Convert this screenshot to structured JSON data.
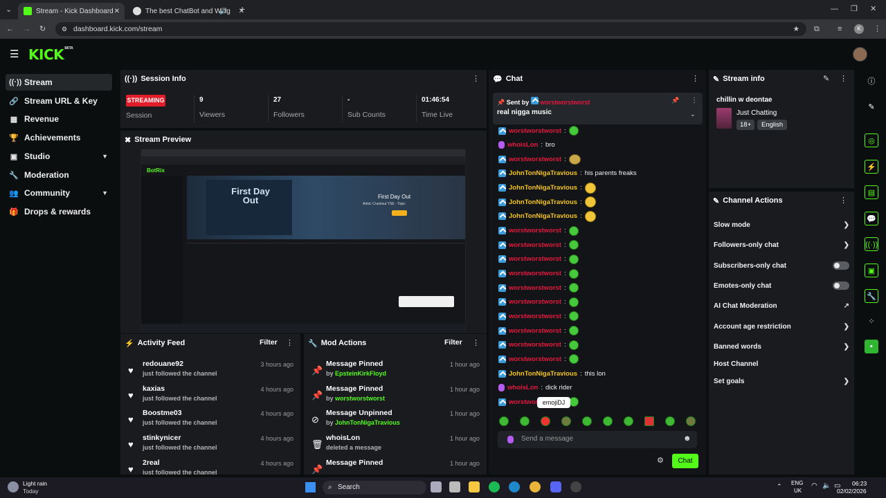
{
  "browser": {
    "tabs": [
      {
        "label": "Stream - Kick Dashboard"
      },
      {
        "label": "The best ChatBot and Widg"
      }
    ],
    "url": "dashboard.kick.com/stream",
    "profile_initial": "K"
  },
  "site": {
    "logo": "KICK",
    "logo_badge": "BETA"
  },
  "nav": {
    "items": [
      {
        "label": "Stream",
        "icon": "stream-icon"
      },
      {
        "label": "Stream URL & Key",
        "icon": "link-icon"
      },
      {
        "label": "Revenue",
        "icon": "revenue-icon"
      },
      {
        "label": "Achievements",
        "icon": "trophy-icon"
      },
      {
        "label": "Studio",
        "icon": "studio-icon"
      },
      {
        "label": "Moderation",
        "icon": "wrench-icon"
      },
      {
        "label": "Community",
        "icon": "community-icon"
      },
      {
        "label": "Drops & rewards",
        "icon": "gift-icon"
      }
    ]
  },
  "session": {
    "title": "Session Info",
    "badge": "STREAMING",
    "stats": [
      {
        "value": "",
        "label": "Session"
      },
      {
        "value": "9",
        "label": "Viewers"
      },
      {
        "value": "27",
        "label": "Followers"
      },
      {
        "value": "-",
        "label": "Sub Counts"
      },
      {
        "value": "01:46:54",
        "label": "Time Live"
      }
    ]
  },
  "preview": {
    "title": "Stream Preview",
    "inner_title": "First Day Out",
    "inner_artist": "Artist: Crashout YSE - Topic",
    "inner_brand": "BotRix"
  },
  "activity": {
    "title": "Activity Feed",
    "filter": "Filter",
    "rows": [
      {
        "name": "redouane92",
        "sub": "just followed the channel",
        "time": "3 hours ago"
      },
      {
        "name": "kaxias",
        "sub": "just followed the channel",
        "time": "4 hours ago"
      },
      {
        "name": "Boostme03",
        "sub": "just followed the channel",
        "time": "4 hours ago"
      },
      {
        "name": "stinkynicer",
        "sub": "just followed the channel",
        "time": "4 hours ago"
      },
      {
        "name": "2real",
        "sub": "just followed the channel",
        "time": "4 hours ago"
      }
    ]
  },
  "modactions": {
    "title": "Mod Actions",
    "filter": "Filter",
    "rows": [
      {
        "action": "Message Pinned",
        "by": "by ",
        "user": "EpsteinKirkFloyd",
        "time": "1 hour ago"
      },
      {
        "action": "Message Pinned",
        "by": "by ",
        "user": "worstworstworst",
        "time": "1 hour ago"
      },
      {
        "action": "Message Unpinned",
        "by": "by ",
        "user": "JohnTonNigaTravious",
        "time": "1 hour ago"
      },
      {
        "action": "whoisLon",
        "by": "deleted a message",
        "user": "",
        "time": "1 hour ago"
      },
      {
        "action": "Message Pinned",
        "by": "",
        "user": "",
        "time": "1 hour ago"
      }
    ]
  },
  "chat": {
    "title": "Chat",
    "pinned_by_label": "Sent by",
    "pinned_by_user": "worstworstworst",
    "pinned_message": "real nigga music",
    "messages": [
      {
        "user": "worstworstworst",
        "text": "",
        "badge": "kick",
        "emote": "green"
      },
      {
        "user": "whoisLon",
        "text": "bro",
        "badge": "mic",
        "emote": ""
      },
      {
        "user": "worstworstworst",
        "text": "",
        "badge": "kick",
        "emote": "big"
      },
      {
        "user": "JohnTonNigaTravious",
        "text": "his parents freaks",
        "badge": "kick",
        "emote": ""
      },
      {
        "user": "JohnTonNigaTravious",
        "text": "",
        "badge": "kick",
        "emote": "yel"
      },
      {
        "user": "JohnTonNigaTravious",
        "text": "",
        "badge": "kick",
        "emote": "yel"
      },
      {
        "user": "JohnTonNigaTravious",
        "text": "",
        "badge": "kick",
        "emote": "yel"
      },
      {
        "user": "worstworstworst",
        "text": "",
        "badge": "kick",
        "emote": "green"
      },
      {
        "user": "worstworstworst",
        "text": "",
        "badge": "kick",
        "emote": "green"
      },
      {
        "user": "worstworstworst",
        "text": "",
        "badge": "kick",
        "emote": "green"
      },
      {
        "user": "worstworstworst",
        "text": "",
        "badge": "kick",
        "emote": "green"
      },
      {
        "user": "worstworstworst",
        "text": "",
        "badge": "kick",
        "emote": "green"
      },
      {
        "user": "worstworstworst",
        "text": "",
        "badge": "kick",
        "emote": "green"
      },
      {
        "user": "worstworstworst",
        "text": "",
        "badge": "kick",
        "emote": "green"
      },
      {
        "user": "worstworstworst",
        "text": "",
        "badge": "kick",
        "emote": "green"
      },
      {
        "user": "worstworstworst",
        "text": "",
        "badge": "kick",
        "emote": "green"
      },
      {
        "user": "worstworstworst",
        "text": "",
        "badge": "kick",
        "emote": "green"
      },
      {
        "user": "JohnTonNigaTravious",
        "text": "this lon",
        "badge": "kick",
        "emote": ""
      },
      {
        "user": "whoisLon",
        "text": "dick rider",
        "badge": "mic",
        "emote": ""
      },
      {
        "user": "worstworstworst",
        "text": "",
        "badge": "kick",
        "emote": "green"
      }
    ],
    "tooltip": "emojiDJ",
    "input_placeholder": "Send a message",
    "send_label": "Chat"
  },
  "streaminfo": {
    "title": "Stream info",
    "stream_title": "chillin w deontae",
    "category": "Just Chatting",
    "tags": [
      "18+",
      "English"
    ]
  },
  "channelactions": {
    "title": "Channel Actions",
    "rows": [
      {
        "label": "Slow mode",
        "control": "chevron"
      },
      {
        "label": "Followers-only chat",
        "control": "chevron"
      },
      {
        "label": "Subscribers-only chat",
        "control": "toggle"
      },
      {
        "label": "Emotes-only chat",
        "control": "toggle"
      },
      {
        "label": "AI Chat Moderation",
        "control": "external"
      },
      {
        "label": "Account age restriction",
        "control": "chevron"
      },
      {
        "label": "Banned words",
        "control": "chevron"
      },
      {
        "label": "Host Channel",
        "control": "none"
      },
      {
        "label": "Set goals",
        "control": "chevron"
      }
    ]
  },
  "taskbar": {
    "weather_title": "Light rain",
    "weather_sub": "Today",
    "search": "Search",
    "lang1": "ENG",
    "lang2": "UK",
    "time": "06:23",
    "date": "02/02/2026"
  },
  "colors": {
    "accent": "#53fc18",
    "username_red": "#e5173f",
    "username_yellow": "#f5c518",
    "streaming_red": "#e11d2a"
  }
}
